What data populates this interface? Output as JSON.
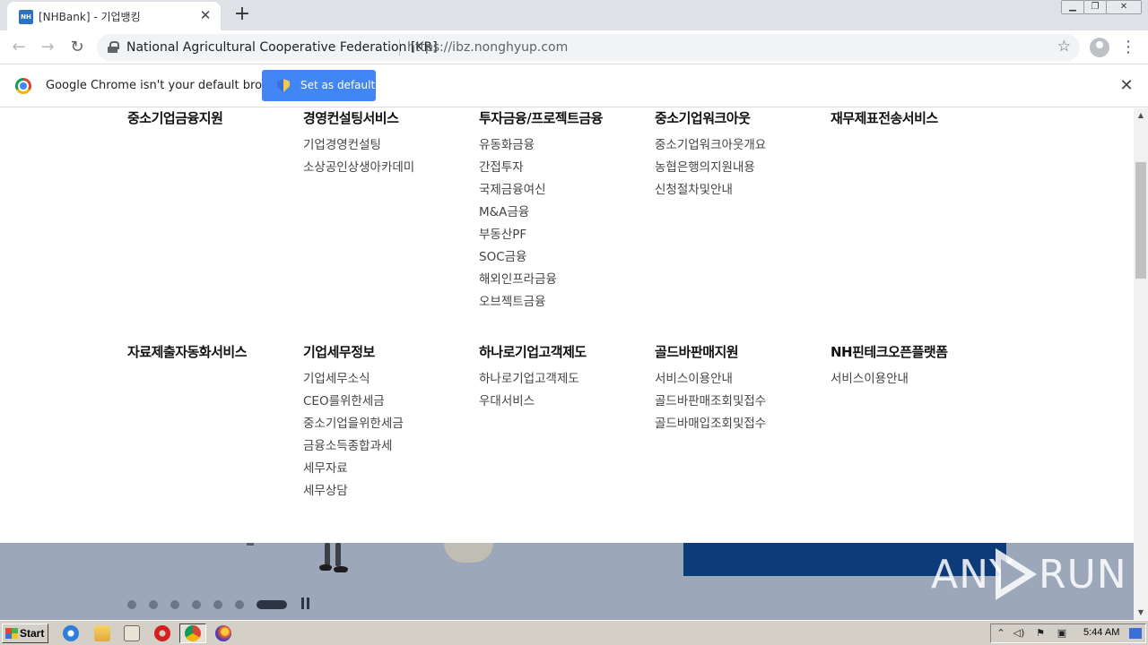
{
  "browser": {
    "tab": {
      "favicon_text": "NH",
      "title": "[NHBank] - 기업뱅킹"
    },
    "site_identity": "National Agricultural Cooperative Federation [KR]",
    "url": "https://ibz.nonghyup.com",
    "infobar": {
      "message": "Google Chrome isn't your default browser",
      "button": "Set as default"
    }
  },
  "menu": {
    "row1": [
      {
        "title": "중소기업금융지원",
        "items": []
      },
      {
        "title": "경영컨설팅서비스",
        "items": [
          "기업경영컨설팅",
          "소상공인상생아카데미"
        ]
      },
      {
        "title": "투자금융/프로젝트금융",
        "items": [
          "유동화금융",
          "간접투자",
          "국제금융여신",
          "M&A금융",
          "부동산PF",
          "SOC금융",
          "해외인프라금융",
          "오브젝트금융"
        ]
      },
      {
        "title": "중소기업워크아웃",
        "items": [
          "중소기업워크아웃개요",
          "농협은행의지원내용",
          "신청절차및안내"
        ]
      },
      {
        "title": "재무제표전송서비스",
        "items": []
      }
    ],
    "row2": [
      {
        "title": "자료제출자동화서비스",
        "items": []
      },
      {
        "title": "기업세무정보",
        "items": [
          "기업세무소식",
          "CEO를위한세금",
          "중소기업을위한세금",
          "금융소득종합과세",
          "세무자료",
          "세무상담"
        ]
      },
      {
        "title": "하나로기업고객제도",
        "items": [
          "하나로기업고객제도",
          "우대서비스"
        ]
      },
      {
        "title": "골드바판매지원",
        "items": [
          "서비스이용안내",
          "골드바판매조회및접수",
          "골드바매입조회및접수"
        ]
      },
      {
        "title": "NH핀테크오픈플랫폼",
        "items": [
          "서비스이용안내"
        ]
      }
    ]
  },
  "carousel": {
    "slide_count": 7,
    "active_index": 6
  },
  "watermark": {
    "left": "ANY",
    "right": "RUN"
  },
  "taskbar": {
    "start": "Start",
    "clock": "5:44 AM"
  },
  "colors": {
    "accent": "#4285f4",
    "hero": "#9ca7ba",
    "panel": "#0d3a78"
  }
}
